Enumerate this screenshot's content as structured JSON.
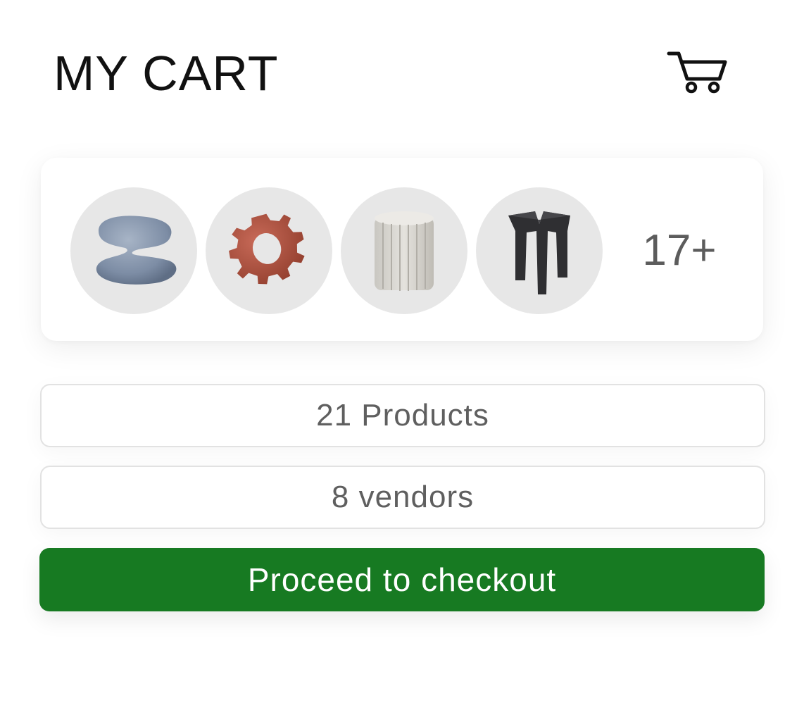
{
  "header": {
    "title": "MY CART",
    "cart_icon": "shopping-cart-icon"
  },
  "preview": {
    "thumbnails": [
      {
        "name": "blue-clay-product-thumbnail",
        "color": "#8494aa"
      },
      {
        "name": "red-gear-product-thumbnail",
        "color": "#b0503f"
      },
      {
        "name": "white-column-product-thumbnail",
        "color": "#d8d6d0"
      },
      {
        "name": "black-stand-product-thumbnail",
        "color": "#2e2e30"
      }
    ],
    "more_count": "17+"
  },
  "summary": {
    "products": "21 Products",
    "vendors": "8 vendors"
  },
  "checkout": {
    "label": "Proceed to checkout",
    "color": "#177a22"
  }
}
